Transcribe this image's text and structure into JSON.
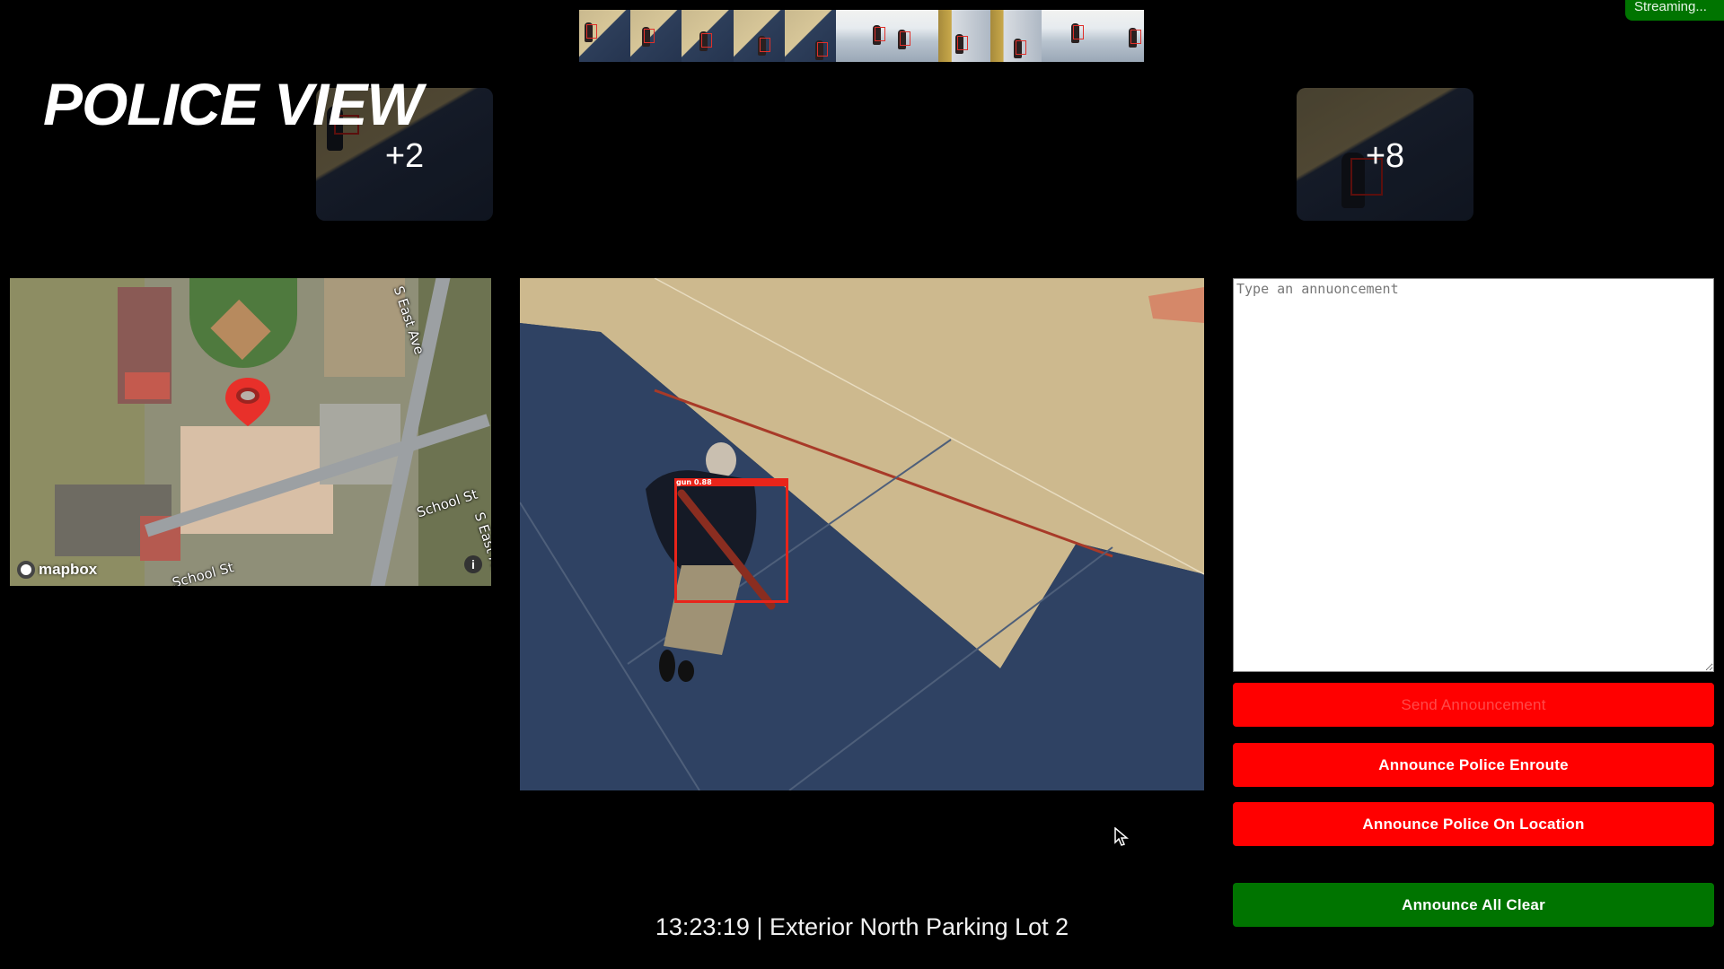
{
  "app": {
    "title": "POLICE VIEW",
    "status_badge": "Streaming..."
  },
  "colors": {
    "alert_red": "#ff0000",
    "clear_green": "#007400",
    "detection_box": "#e8241a",
    "background": "#000000"
  },
  "timeline": {
    "frame_count": 11,
    "selected_index": 2,
    "frames": [
      {
        "scene": "shadow",
        "detection": true
      },
      {
        "scene": "shadow",
        "detection": true
      },
      {
        "scene": "shadow",
        "detection": true
      },
      {
        "scene": "shadow",
        "detection": true
      },
      {
        "scene": "shadow",
        "detection": true
      },
      {
        "scene": "bright",
        "detection": true
      },
      {
        "scene": "bright",
        "detection": true
      },
      {
        "scene": "door",
        "detection": true
      },
      {
        "scene": "door",
        "detection": true
      },
      {
        "scene": "bright",
        "detection": true
      },
      {
        "scene": "bright",
        "detection": true
      }
    ]
  },
  "camera_cards": [
    {
      "label": "+2",
      "position": "left"
    },
    {
      "label": "+8",
      "position": "right"
    }
  ],
  "map": {
    "provider_logo": "mapbox",
    "info_icon": "i",
    "street_labels": [
      "S East Ave",
      "School St",
      "School St",
      "S East Ave"
    ],
    "marker_icon": "location-pin-icon"
  },
  "video": {
    "detection": {
      "label": "gun",
      "confidence": "0.88"
    }
  },
  "announcement": {
    "placeholder": "Type an annuoncement",
    "value": ""
  },
  "buttons": {
    "send": "Send Announcement",
    "enroute": "Announce Police Enroute",
    "on_location": "Announce Police On Location",
    "all_clear": "Announce All Clear"
  },
  "caption": {
    "time": "13:23:19",
    "separator": "|",
    "location": "Exterior North Parking Lot 2"
  }
}
